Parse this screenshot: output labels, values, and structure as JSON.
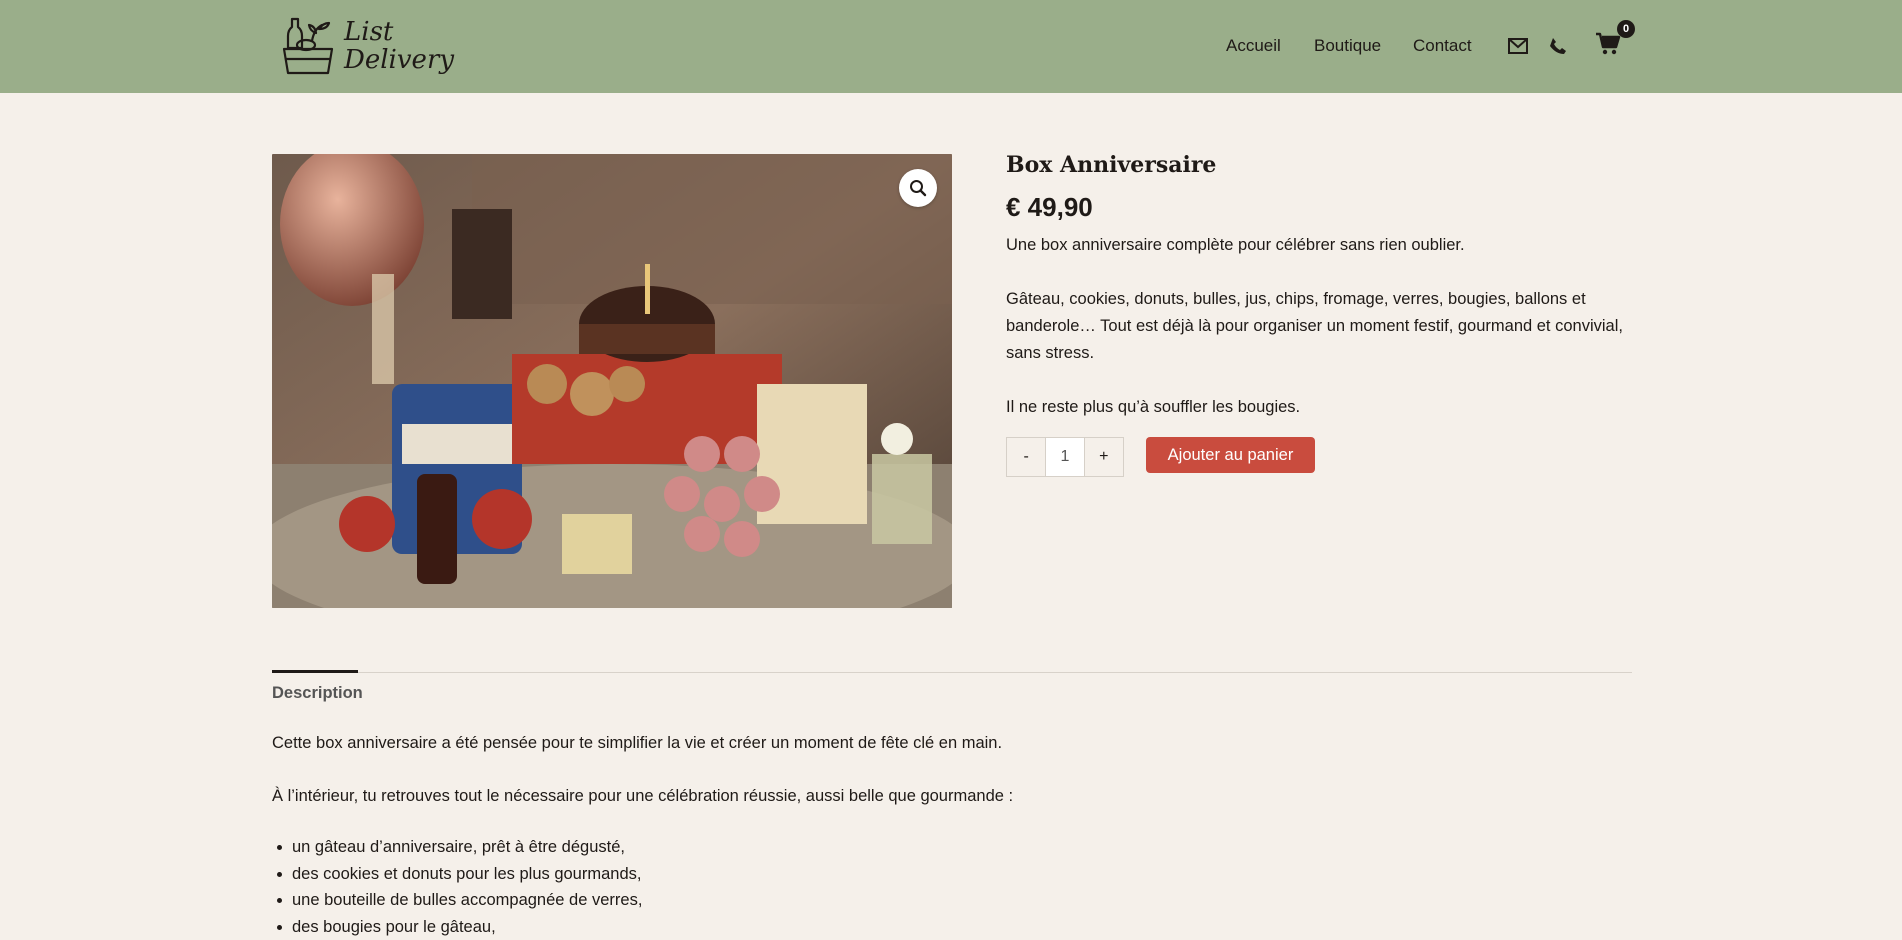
{
  "header": {
    "logo_line1": "List",
    "logo_line2": "Delivery",
    "nav": [
      "Accueil",
      "Boutique",
      "Contact"
    ],
    "cart_count": "0",
    "icons": [
      "envelope-icon",
      "phone-icon",
      "cart-icon"
    ]
  },
  "product": {
    "title": "Box Anniversaire",
    "price": "€ 49,90",
    "short_description": "Une box anniversaire complète pour célébrer sans rien oublier.",
    "details": "Gâteau, cookies, donuts, bulles, jus, chips, fromage, verres, bougies, ballons et banderole… Tout est déjà là pour organiser un moment festif, gourmand et convivial, sans stress.",
    "closing": "Il ne reste plus qu’à souffler les bougies.",
    "quantity": "1",
    "minus_label": "-",
    "plus_label": "+",
    "add_to_cart_label": "Ajouter au panier"
  },
  "tabs": {
    "description_label": "Description"
  },
  "description": {
    "intro": "Cette box anniversaire a été pensée pour te simplifier la vie et créer un moment de fête clé en main.",
    "inside": "À l’intérieur, tu retrouves tout le nécessaire pour une célébration réussie, aussi belle que gourmande :",
    "items": [
      "un gâteau d’anniversaire, prêt à être dégusté,",
      "des cookies et donuts pour les plus gourmands,",
      "une bouteille de bulles accompagnée de verres,",
      "des bougies pour le gâteau,"
    ]
  },
  "colors": {
    "header_bg": "#9aae8a",
    "page_bg": "#f5f0ea",
    "button": "#c94c3e",
    "text": "#1f1a17"
  }
}
